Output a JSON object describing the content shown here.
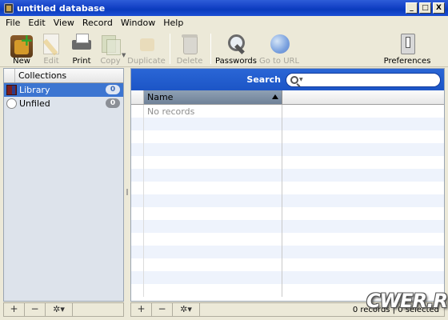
{
  "window": {
    "title": "untitled database",
    "controls": {
      "minimize": "_",
      "maximize": "□",
      "close": "X"
    }
  },
  "menubar": [
    "File",
    "Edit",
    "View",
    "Record",
    "Window",
    "Help"
  ],
  "toolbar": {
    "new": "New",
    "edit": "Edit",
    "print": "Print",
    "copy": "Copy",
    "duplicate": "Duplicate",
    "delete": "Delete",
    "passwords": "Passwords",
    "go_to_url": "Go to URL",
    "preferences": "Preferences"
  },
  "collections": {
    "header": "Collections",
    "items": [
      {
        "label": "Library",
        "count": "0",
        "icon": "library-icon",
        "selected": true
      },
      {
        "label": "Unfiled",
        "count": "0",
        "icon": "unfiled-icon",
        "selected": false
      }
    ]
  },
  "search": {
    "label": "Search",
    "value": ""
  },
  "table": {
    "columns": [
      "Name"
    ],
    "sort": "ascending",
    "empty_text": "No records"
  },
  "bottom": {
    "add": "+",
    "remove": "−",
    "gear": "✲▾",
    "status": "0 records | 0 selected"
  },
  "watermark": "CWER.RU",
  "colors": {
    "titlebar": "#0a3bbd",
    "search_bar": "#1c55c6",
    "selection": "#3c75d1",
    "stripe": "#eef3fc",
    "sidebar": "#dde3eb"
  }
}
